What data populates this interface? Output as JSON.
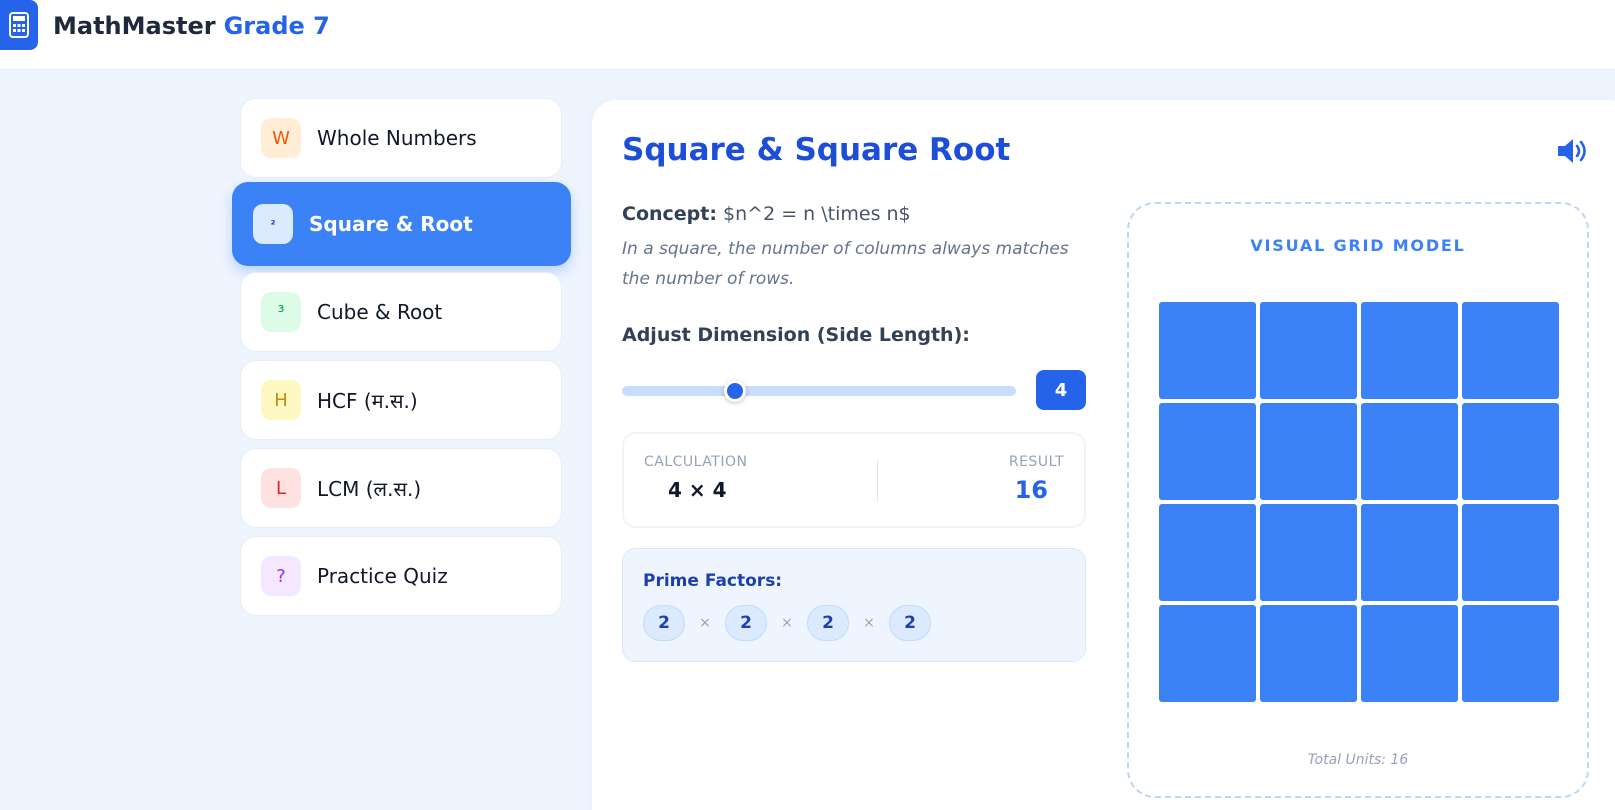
{
  "header": {
    "title": "MathMaster",
    "grade": "Grade 7",
    "logo_icon": "calculator-icon"
  },
  "sidebar": {
    "items": [
      {
        "badge": "W",
        "label": "Whole Numbers",
        "badge_bg": "#ffedd5",
        "badge_color": "#ea580c",
        "active": false
      },
      {
        "badge": "²",
        "label": "Square & Root",
        "badge_bg": "#dbeafe",
        "badge_color": "#1e40af",
        "active": true
      },
      {
        "badge": "³",
        "label": "Cube & Root",
        "badge_bg": "#dcfce7",
        "badge_color": "#16a34a",
        "active": false
      },
      {
        "badge": "H",
        "label": "HCF (म.स.)",
        "badge_bg": "#fef9c3",
        "badge_color": "#ca8a04",
        "active": false
      },
      {
        "badge": "L",
        "label": "LCM (ल.स.)",
        "badge_bg": "#fee2e2",
        "badge_color": "#dc2626",
        "active": false
      },
      {
        "badge": "?",
        "label": "Practice Quiz",
        "badge_bg": "#f3e8ff",
        "badge_color": "#9333ea",
        "active": false
      }
    ]
  },
  "main": {
    "title": "Square & Square Root",
    "speaker_icon": "speaker-icon",
    "concept_label": "Concept:",
    "concept_formula": "$n^2 = n \\times n$",
    "concept_desc": "In a square, the number of columns always matches the number of rows.",
    "adjust_label": "Adjust Dimension (Side Length):",
    "slider": {
      "value": 4,
      "min": 1,
      "max": 12
    },
    "calc_label": "CALCULATION",
    "calc_value": "4 × 4",
    "result_label": "RESULT",
    "result_value": "16",
    "prime_label": "Prime Factors:",
    "prime_factors": [
      "2",
      "2",
      "2",
      "2"
    ],
    "times_symbol": "×",
    "grid_title": "VISUAL GRID MODEL",
    "grid_size": 4,
    "total_units": "Total Units: 16"
  },
  "colors": {
    "accent": "#2563eb",
    "active_item": "#3b82f6",
    "grid_cell": "#3b82f6"
  }
}
